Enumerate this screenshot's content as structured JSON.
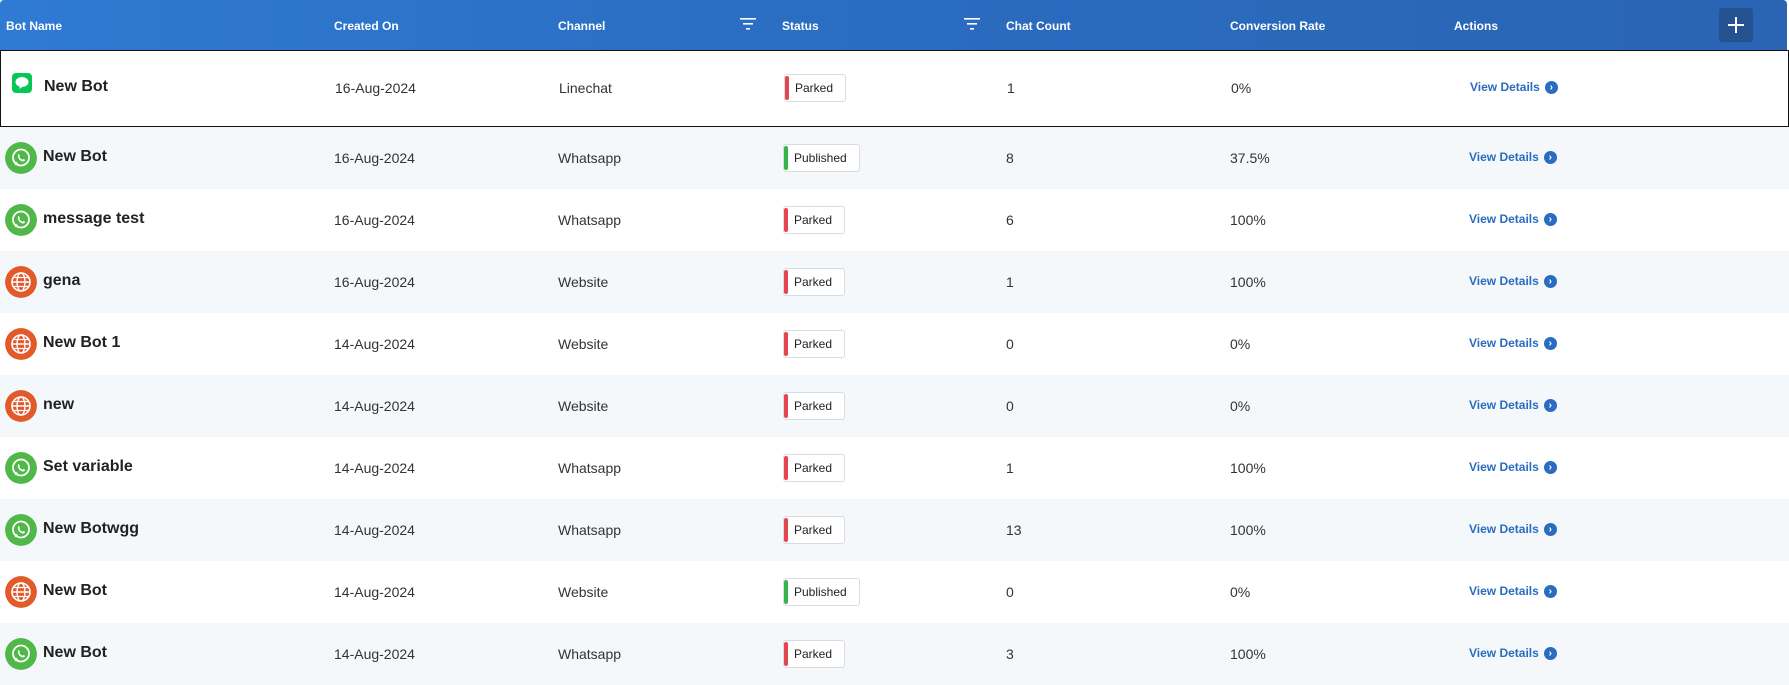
{
  "header": {
    "bot_name": "Bot Name",
    "created_on": "Created On",
    "channel": "Channel",
    "status": "Status",
    "chat_count": "Chat Count",
    "conversion_rate": "Conversion Rate",
    "actions": "Actions",
    "add_icon": "plus-icon",
    "filter_icon": "filter-icon"
  },
  "colors": {
    "header_start": "#2f7ad3",
    "header_end": "#2a64b3",
    "parked": "#e2474f",
    "published": "#33b54a",
    "link": "#2a6cc0",
    "whatsapp": "#4fb849",
    "website": "#e35a2a",
    "linechat": "#06c755"
  },
  "view_details_label": "View Details",
  "rows": [
    {
      "name": "New Bot",
      "created_on": "16-Aug-2024",
      "channel": "Linechat",
      "status": "Parked",
      "chat_count": "1",
      "conversion_rate": "0%"
    },
    {
      "name": "New Bot",
      "created_on": "16-Aug-2024",
      "channel": "Whatsapp",
      "status": "Published",
      "chat_count": "8",
      "conversion_rate": "37.5%"
    },
    {
      "name": "message test",
      "created_on": "16-Aug-2024",
      "channel": "Whatsapp",
      "status": "Parked",
      "chat_count": "6",
      "conversion_rate": "100%"
    },
    {
      "name": "gena",
      "created_on": "16-Aug-2024",
      "channel": "Website",
      "status": "Parked",
      "chat_count": "1",
      "conversion_rate": "100%"
    },
    {
      "name": "New Bot 1",
      "created_on": "14-Aug-2024",
      "channel": "Website",
      "status": "Parked",
      "chat_count": "0",
      "conversion_rate": "0%"
    },
    {
      "name": "new",
      "created_on": "14-Aug-2024",
      "channel": "Website",
      "status": "Parked",
      "chat_count": "0",
      "conversion_rate": "0%"
    },
    {
      "name": "Set variable",
      "created_on": "14-Aug-2024",
      "channel": "Whatsapp",
      "status": "Parked",
      "chat_count": "1",
      "conversion_rate": "100%"
    },
    {
      "name": "New Botwgg",
      "created_on": "14-Aug-2024",
      "channel": "Whatsapp",
      "status": "Parked",
      "chat_count": "13",
      "conversion_rate": "100%"
    },
    {
      "name": "New Bot",
      "created_on": "14-Aug-2024",
      "channel": "Website",
      "status": "Published",
      "chat_count": "0",
      "conversion_rate": "0%"
    },
    {
      "name": "New Bot",
      "created_on": "14-Aug-2024",
      "channel": "Whatsapp",
      "status": "Parked",
      "chat_count": "3",
      "conversion_rate": "100%"
    }
  ]
}
